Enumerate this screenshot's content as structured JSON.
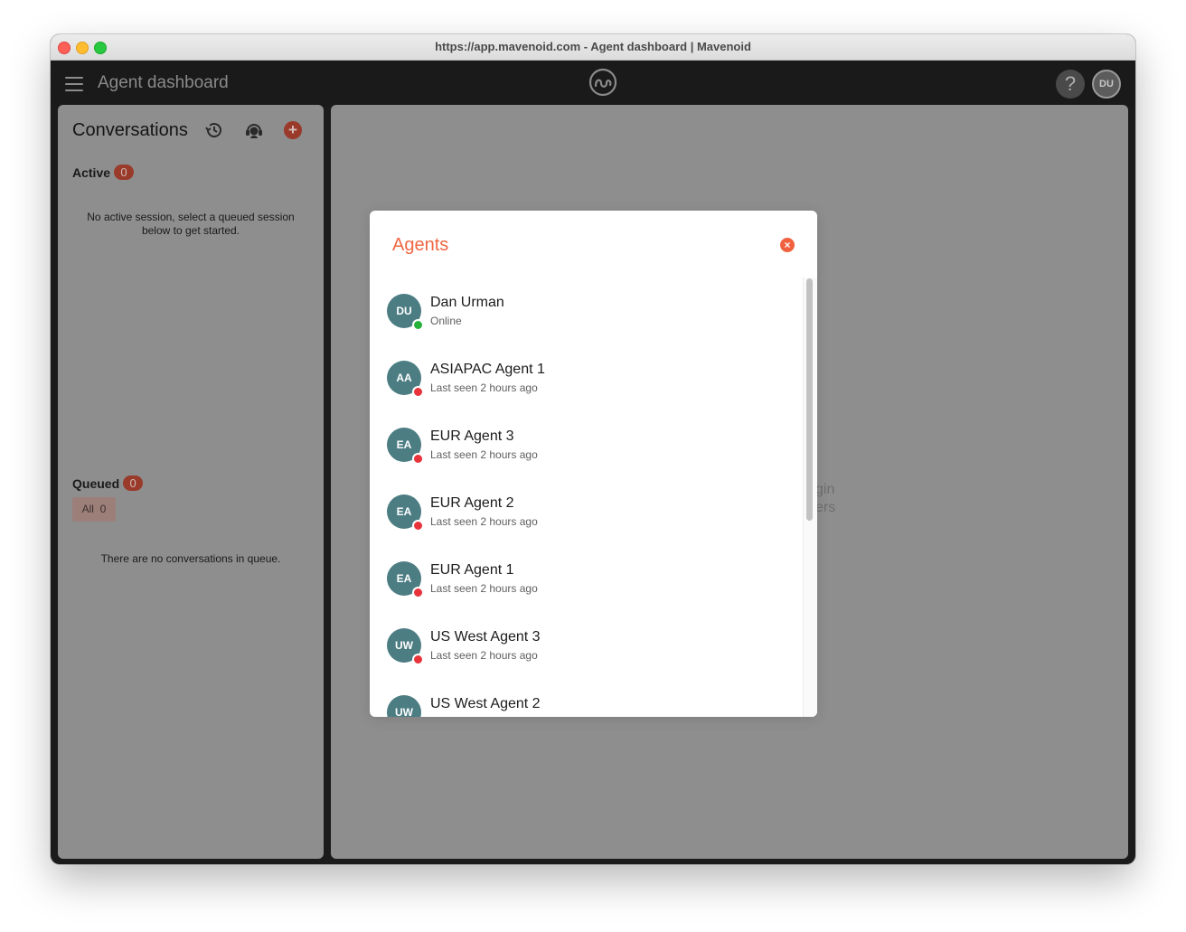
{
  "window": {
    "title": "https://app.mavenoid.com - Agent dashboard | Mavenoid"
  },
  "appbar": {
    "title": "Agent dashboard",
    "help_label": "?",
    "user_initials": "DU"
  },
  "conversations": {
    "title": "Conversations",
    "active": {
      "label": "Active",
      "count": "0",
      "empty_message": "No active session, select a queued session below to get started."
    },
    "queued": {
      "label": "Queued",
      "count": "0",
      "filter_label": "All",
      "filter_count": "0",
      "empty_message": "There are no conversations in queue."
    }
  },
  "main": {
    "partial_text_line1": "gin",
    "partial_text_line2": "ers"
  },
  "agents_modal": {
    "title": "Agents",
    "agents": [
      {
        "initials": "DU",
        "name": "Dan Urman",
        "status": "Online",
        "online": true
      },
      {
        "initials": "AA",
        "name": "ASIAPAC Agent 1",
        "status": "Last seen 2 hours ago",
        "online": false
      },
      {
        "initials": "EA",
        "name": "EUR Agent 3",
        "status": "Last seen 2 hours ago",
        "online": false
      },
      {
        "initials": "EA",
        "name": "EUR Agent 2",
        "status": "Last seen 2 hours ago",
        "online": false
      },
      {
        "initials": "EA",
        "name": "EUR Agent 1",
        "status": "Last seen 2 hours ago",
        "online": false
      },
      {
        "initials": "UW",
        "name": "US West Agent 3",
        "status": "Last seen 2 hours ago",
        "online": false
      },
      {
        "initials": "UW",
        "name": "US West Agent 2",
        "status": "",
        "online": false
      }
    ]
  },
  "colors": {
    "accent": "#f06643",
    "badge": "#9a3a2a",
    "avatar": "#4c7d83",
    "online": "#27b23a",
    "offline": "#e8333a"
  },
  "icons": [
    "menu-icon",
    "mavenoid-logo-icon",
    "history-icon",
    "agents-icon",
    "plus-icon",
    "close-icon",
    "help-icon"
  ]
}
